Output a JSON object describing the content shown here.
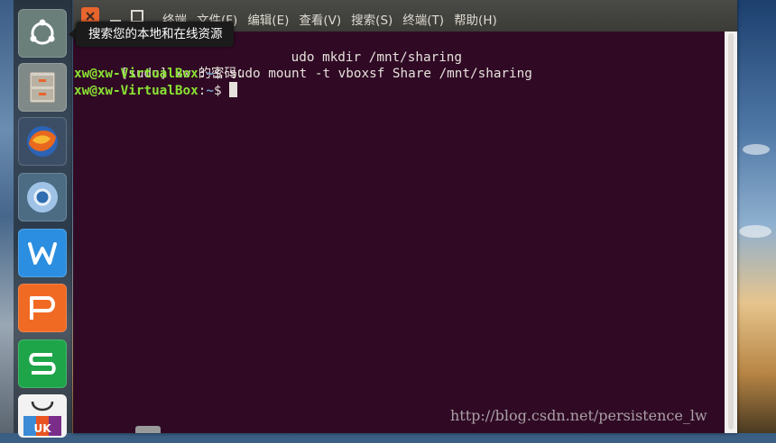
{
  "launcher": {
    "tooltip": "搜索您的本地和在线资源",
    "items": [
      {
        "name": "ubuntu-dash",
        "icon": "ubuntu-logo-icon"
      },
      {
        "name": "files",
        "icon": "file-cabinet-icon"
      },
      {
        "name": "firefox",
        "icon": "firefox-icon"
      },
      {
        "name": "chromium",
        "icon": "chromium-icon"
      },
      {
        "name": "wps-writer",
        "icon": "wps-writer-icon",
        "letter": "W"
      },
      {
        "name": "wps-presentation",
        "icon": "wps-presentation-icon",
        "letter": "P"
      },
      {
        "name": "wps-spreadsheets",
        "icon": "wps-spreadsheets-icon",
        "letter": "S"
      },
      {
        "name": "ubuntu-software",
        "icon": "software-bag-icon",
        "letter": "UK"
      }
    ]
  },
  "window": {
    "menu": [
      "终端",
      "文件(F)",
      "编辑(E)",
      "查看(V)",
      "搜索(S)",
      "终端(T)",
      "帮助(H)"
    ],
    "colors": {
      "background": "#300a24",
      "user": "#8ae234",
      "path": "#729fcf",
      "text": "#e6e1dc"
    }
  },
  "terminal": {
    "line1_text": "udo mkdir /mnt/sharing",
    "line2_text": "[sudo] xw 的密码：",
    "line3_user": "xw@xw-VirtualBox",
    "line3_colon": ":",
    "line3_path": "~",
    "line3_cmd": "$ sudo mount -t vboxsf Share /mnt/sharing",
    "line4_user": "xw@xw-VirtualBox",
    "line4_colon": ":",
    "line4_path": "~",
    "line4_cmd": "$ "
  },
  "watermark": "http://blog.csdn.net/persistence_lw"
}
